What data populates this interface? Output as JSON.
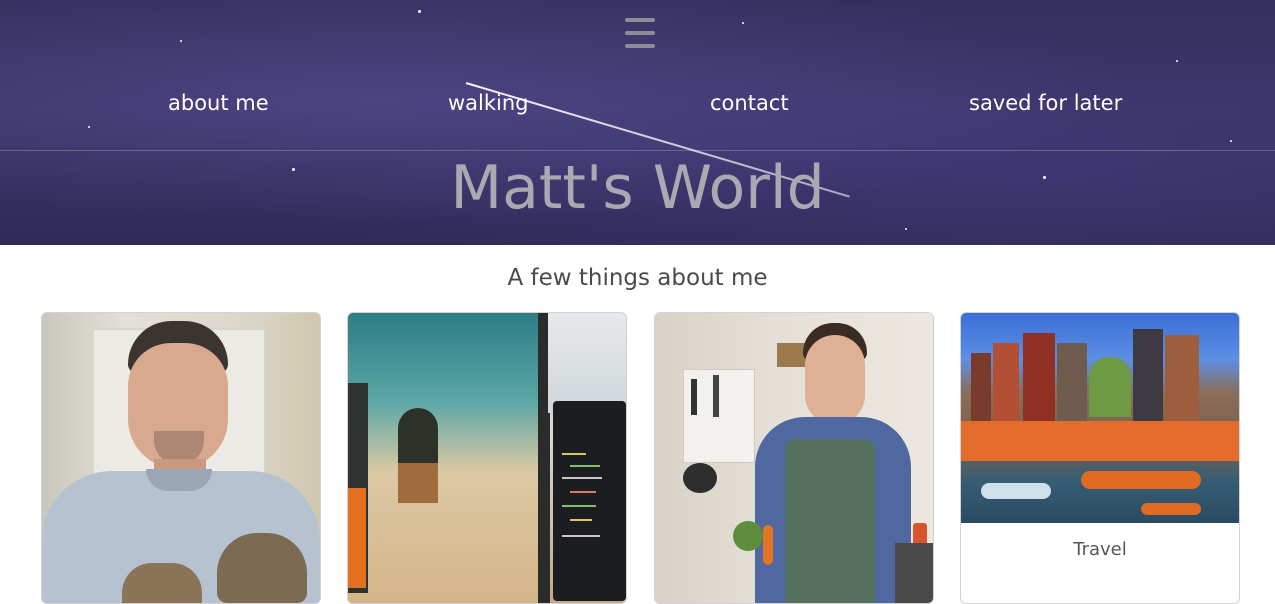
{
  "header": {
    "nav": [
      "about me",
      "walking",
      "contact",
      "saved for later"
    ],
    "title": "Matt's World"
  },
  "main": {
    "subtitle": "A few things about me",
    "cards": [
      {
        "image": "person-with-cat-photo",
        "caption": ""
      },
      {
        "image": "monitors-desk-photo",
        "caption": ""
      },
      {
        "image": "person-cooking-photo",
        "caption": ""
      },
      {
        "image": "amsterdam-canal-photo",
        "caption": "Travel"
      }
    ]
  }
}
